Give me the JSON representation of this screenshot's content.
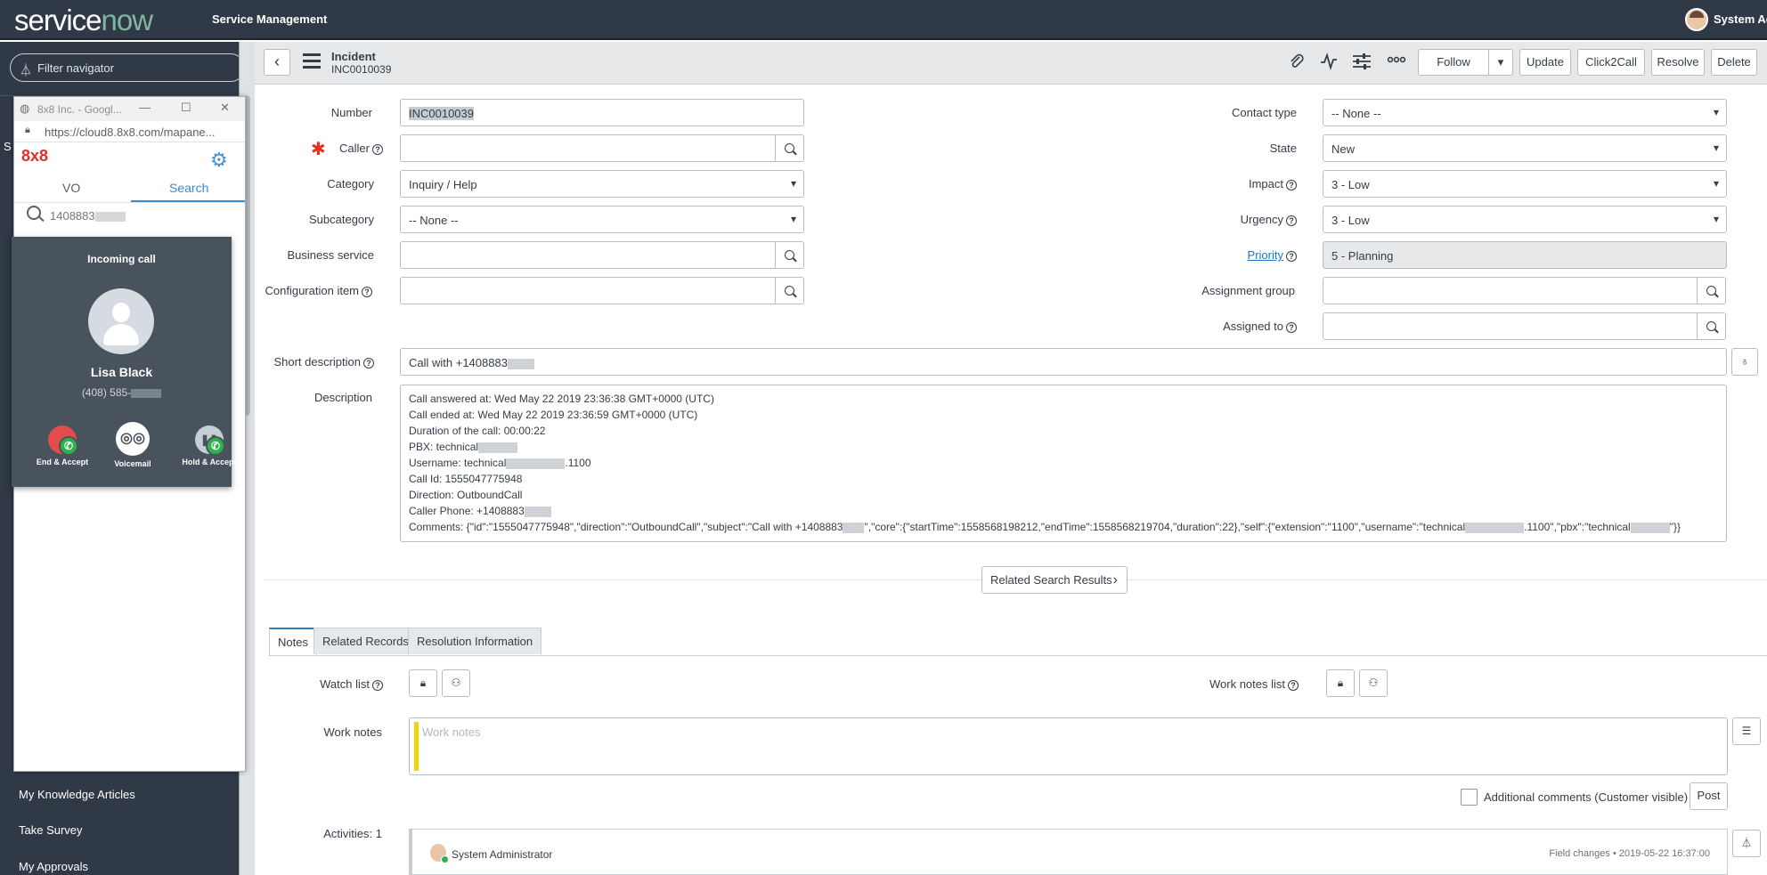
{
  "banner": {
    "logo_left": "service",
    "logo_right": "now",
    "product": "Service Management",
    "user_name": "System Adr"
  },
  "nav": {
    "filter_placeholder": "Filter navigator",
    "items": [
      {
        "label": "My Knowledge Articles"
      },
      {
        "label": "Take Survey"
      },
      {
        "label": "My Approvals"
      }
    ],
    "partial_letter": "S"
  },
  "popup": {
    "title": "8x8 Inc. - Googl...",
    "url": "https://cloud8.8x8.com/mapane...",
    "brand": "8x8",
    "tabs": [
      "VO",
      "Search"
    ],
    "search_value": "1408883",
    "call": {
      "status": "Incoming call",
      "caller_name": "Lisa Black",
      "caller_phone": "(408) 585-",
      "buttons": [
        {
          "label": "End & Accept"
        },
        {
          "label": "Voicemail"
        },
        {
          "label": "Hold & Accept"
        }
      ]
    }
  },
  "header": {
    "record_type": "Incident",
    "record_number": "INC0010039",
    "buttons": {
      "follow": "Follow",
      "update": "Update",
      "click2call": "Click2Call",
      "resolve": "Resolve",
      "delete": "Delete"
    }
  },
  "form": {
    "left": {
      "number": {
        "label": "Number",
        "value": "INC0010039"
      },
      "caller": {
        "label": "Caller",
        "value": ""
      },
      "category": {
        "label": "Category",
        "value": "Inquiry / Help"
      },
      "subcategory": {
        "label": "Subcategory",
        "value": "-- None --"
      },
      "business_service": {
        "label": "Business service",
        "value": ""
      },
      "configuration_item": {
        "label": "Configuration item",
        "value": ""
      }
    },
    "right": {
      "contact_type": {
        "label": "Contact type",
        "value": "-- None --"
      },
      "state": {
        "label": "State",
        "value": "New"
      },
      "impact": {
        "label": "Impact",
        "value": "3 - Low"
      },
      "urgency": {
        "label": "Urgency",
        "value": "3 - Low"
      },
      "priority": {
        "label": "Priority",
        "value": "5 - Planning"
      },
      "assignment_group": {
        "label": "Assignment group",
        "value": ""
      },
      "assigned_to": {
        "label": "Assigned to",
        "value": ""
      }
    },
    "short_description": {
      "label": "Short description",
      "value": "Call with +1408883"
    },
    "description": {
      "label": "Description",
      "lines": [
        "Call answered at: Wed May 22 2019 23:36:38 GMT+0000 (UTC)",
        "Call ended at: Wed May 22 2019 23:36:59 GMT+0000 (UTC)",
        "Duration of the call: 00:00:22",
        "PBX: technical",
        "Username: technical",
        ".1100",
        "Call Id: 1555047775948",
        "Direction: OutboundCall",
        "Caller Phone: +1408883",
        "Comments: {\"id\":\"1555047775948\",\"direction\":\"OutboundCall\",\"subject\":\"Call with +1408883",
        "\",\"core\":{\"startTime\":1558568198212,\"endTime\":1558568219704,\"duration\":22},\"self\":{\"extension\":\"1100\",\"username\":\"technical",
        ".1100\",\"pbx\":\"technical",
        "\"}}"
      ]
    },
    "related_search": "Related Search Results"
  },
  "tabs": [
    "Notes",
    "Related Records",
    "Resolution Information"
  ],
  "notes": {
    "watch_list": "Watch list",
    "work_notes_list": "Work notes list",
    "work_notes_label": "Work notes",
    "work_notes_placeholder": "Work notes",
    "additional_comments": "Additional comments (Customer visible)",
    "post": "Post",
    "activities": "Activities: 1",
    "activity_user": "System Administrator",
    "activity_meta": "Field changes  •  2019-05-22 16:37:00"
  },
  "colors": {
    "banner": "#303a46",
    "accent": "#2d7ebf",
    "mandatory": "#e0311f",
    "brand_8x8": "#e52d27",
    "call_green": "#2db14a",
    "call_red": "#e24c4b"
  },
  "icons": [
    "filter-icon",
    "lock-icon",
    "gear-icon",
    "search-icon",
    "paperclip-icon",
    "activity-icon",
    "settings-sliders-icon",
    "more-icon",
    "back-icon",
    "hamburger-icon",
    "lightbulb-icon",
    "chevron-right-icon",
    "lock-icon",
    "add-user-icon",
    "stream-icon",
    "filter-icon"
  ]
}
